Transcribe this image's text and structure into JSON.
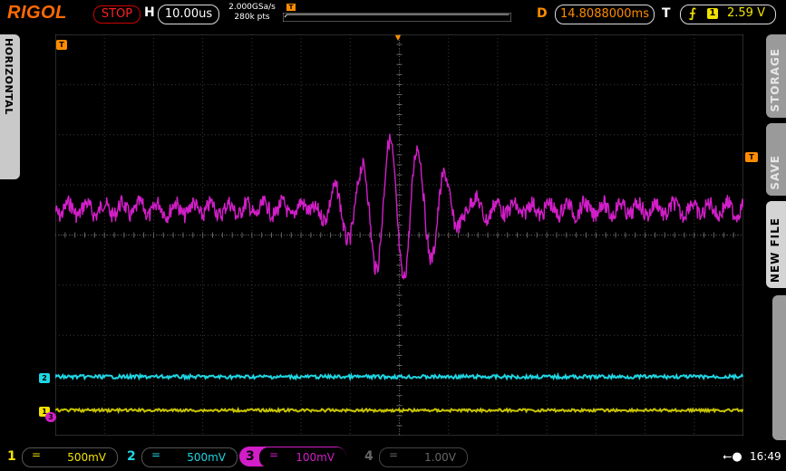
{
  "top": {
    "logo": "RIGOL",
    "run_state": "STOP",
    "h_label": "H",
    "timebase": "10.00us",
    "sample_rate": "2.000GSa/s",
    "memory_depth": "280k pts",
    "mem_marker": "T",
    "d_label": "D",
    "delay": "14.8088000ms",
    "t_label": "T",
    "trigger_source": "1",
    "trigger_level": "2.59 V"
  },
  "left_tab": {
    "label": "HORIZONTAL"
  },
  "right_tabs": [
    {
      "label": "STORAGE"
    },
    {
      "label": "SAVE"
    },
    {
      "label": "NEW FILE"
    }
  ],
  "markers": {
    "trigger_pos": "T",
    "left_t": "T",
    "right_t": "T",
    "ch2": "2",
    "ch1": "1",
    "ch3": "3"
  },
  "channels": [
    {
      "num": "1",
      "coupling": "=",
      "scale": "500mV",
      "color": "#f2e200",
      "enabled": true
    },
    {
      "num": "2",
      "coupling": "=",
      "scale": "500mV",
      "color": "#1fd6e3",
      "enabled": true
    },
    {
      "num": "3",
      "coupling": "=",
      "scale": "100mV",
      "color": "#d21ec8",
      "enabled": true,
      "active": true
    },
    {
      "num": "4",
      "coupling": "=",
      "scale": "1.00V",
      "color": "#555555",
      "enabled": false
    }
  ],
  "status": {
    "usb_icon": "usb-icon",
    "time": "16:49"
  },
  "colors": {
    "accent_orange": "#ff8c00",
    "grid": "#3a3a3a"
  }
}
